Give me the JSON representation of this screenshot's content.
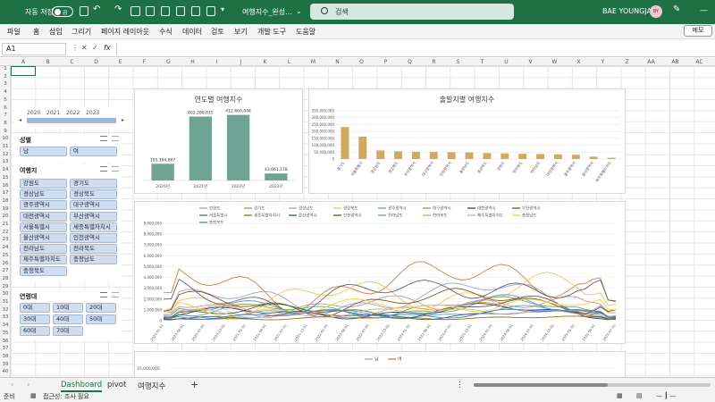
{
  "titlebar": {
    "autosave_label": "자동 저장",
    "toggle_state": "끔",
    "filename": "여행지수_완성...",
    "search_placeholder": "검색",
    "username": "BAE YOUNGJA",
    "avatar_initials": "BY"
  },
  "menu": {
    "items": [
      "파일",
      "홈",
      "삽입",
      "그리기",
      "페이지 레이아웃",
      "수식",
      "데이터",
      "검토",
      "보기",
      "개발 도구",
      "도움말"
    ],
    "memo_label": "메모"
  },
  "formula_bar": {
    "name_box": "A1",
    "fx_label": "fx",
    "value": ""
  },
  "columns": [
    "A",
    "B",
    "C",
    "D",
    "E",
    "F",
    "G",
    "H",
    "I",
    "J",
    "K",
    "L",
    "M",
    "N",
    "O",
    "P",
    "Q",
    "R",
    "S",
    "T",
    "U",
    "V",
    "W",
    "X",
    "Y",
    "Z",
    "AA",
    "AB",
    "AC"
  ],
  "rows": [
    "1",
    "2",
    "3",
    "4",
    "5",
    "6",
    "7",
    "8",
    "9",
    "10",
    "11",
    "12",
    "13",
    "14",
    "15",
    "16",
    "17",
    "18",
    "19",
    "20",
    "21",
    "22",
    "23",
    "24",
    "25",
    "26",
    "27",
    "28",
    "29",
    "30",
    "31",
    "32",
    "33",
    "34",
    "35",
    "36",
    "37",
    "38",
    "39",
    "40"
  ],
  "timeline": {
    "years": [
      "2020",
      "2021",
      "2022",
      "2023"
    ]
  },
  "slicer_gender": {
    "title": "성별",
    "items": [
      "남",
      "여"
    ]
  },
  "slicer_region": {
    "title": "여행지",
    "items": [
      "강원도",
      "경기도",
      "경상남도",
      "경상북도",
      "광주광역시",
      "대구광역시",
      "대전광역시",
      "부산광역시",
      "서울특별시",
      "세종특별자치시",
      "울산광역시",
      "인천광역시",
      "전라남도",
      "전라북도",
      "제주특별자치도",
      "충청남도",
      "충청북도"
    ]
  },
  "slicer_age": {
    "title": "연령대",
    "items": [
      "0대",
      "10대",
      "20대",
      "30대",
      "40대",
      "50대",
      "60대",
      "70대"
    ]
  },
  "chart_data": [
    {
      "type": "bar",
      "title": "연도별 여행지수",
      "categories": [
        "2020년",
        "2021년",
        "2022년",
        "2023년"
      ],
      "values": [
        105194867,
        402280015,
        412660044,
        43661178
      ],
      "data_labels": [
        "105,194,867",
        "402,280,015",
        "412,660,044",
        "43,661,178"
      ],
      "color": "#6fa393"
    },
    {
      "type": "bar",
      "title": "출발지별 여행지수",
      "categories": [
        "경기도",
        "서울특별시",
        "경상남도",
        "경상북도",
        "부산광역시",
        "대구광역시",
        "인천광역시",
        "충청남도",
        "경상북도",
        "강원도",
        "전라북도",
        "전라남도",
        "대전광역시",
        "광주광역시",
        "울산광역시",
        "제주특별자치도"
      ],
      "values": [
        232000000,
        162000000,
        62000000,
        56000000,
        53000000,
        51000000,
        49000000,
        47000000,
        43000000,
        41000000,
        38000000,
        36000000,
        34000000,
        31000000,
        17000000,
        9000000
      ],
      "y_ticks": [
        "0",
        "50,000,000",
        "100,000,000",
        "150,000,000",
        "200,000,000",
        "250,000,000",
        "300,000,000",
        "350,000,000"
      ],
      "ylim": [
        0,
        350000000
      ],
      "color": "#d4aa5a"
    },
    {
      "type": "line",
      "legend": [
        "강원도",
        "경기도",
        "경상남도",
        "경상북도",
        "광주광역시",
        "대구광역시",
        "대전광역시",
        "부산광역시",
        "서울특별시",
        "세종특별자치시",
        "울산광역시",
        "인천광역시",
        "전라남도",
        "전라북도",
        "제주특별자치도",
        "충청남도",
        "충청북도"
      ],
      "colors": [
        "#8ea9db",
        "#e07b39",
        "#a5a5a5",
        "#f2c45a",
        "#5b9bd5",
        "#70ad47",
        "#264478",
        "#9e480e",
        "#636363",
        "#997300",
        "#255e91",
        "#43682b",
        "#698ed0",
        "#f1975a",
        "#b7b7b7",
        "#ffcd33",
        "#4c7cc4"
      ],
      "x_labels": [
        "2020-01-01",
        "2020-04-01",
        "2020-07-01",
        "2020-10-01",
        "2021-01-01",
        "2021-04-01",
        "2021-07-01",
        "2021-10-01",
        "2022-01-01",
        "2022-04-01",
        "2022-07-01",
        "2022-10-01",
        "2023-01-01",
        "2023-04-01",
        "2023-07-01",
        "2023-10-01",
        "2024-01-01",
        "2024-04-01",
        "2024-07-01",
        "2024-10-01",
        "2025-01-01",
        "2025-04-01",
        "2025-07-01"
      ],
      "y_ticks": [
        "0",
        "1,000,000",
        "2,000,000",
        "3,000,000",
        "4,000,000",
        "5,000,000",
        "6,000,000",
        "7,000,000",
        "8,000,000",
        "9,000,000"
      ],
      "ylim": [
        0,
        9000000
      ]
    },
    {
      "type": "line",
      "legend": [
        "남",
        "여"
      ],
      "colors": [
        "#8ea9db",
        "#e07b39"
      ],
      "y_ticks": [
        "35,000,000"
      ]
    }
  ],
  "sheet_tabs": [
    "Dashboard",
    "pivot",
    "여행지수"
  ],
  "status": {
    "ready": "준비",
    "accessibility": "접근성: 조사 필요"
  }
}
